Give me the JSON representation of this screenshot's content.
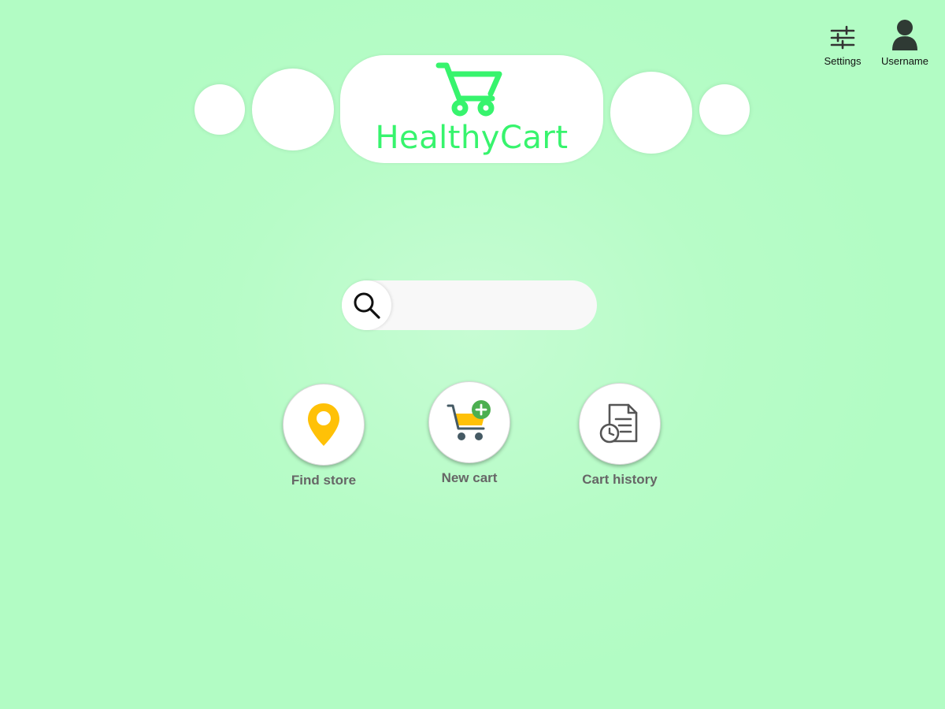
{
  "header": {
    "settings": {
      "label": "Settings",
      "icon": "settings-sliders-icon"
    },
    "user": {
      "label": "Username",
      "icon": "user-icon"
    }
  },
  "logo": {
    "text": "HealthyCart",
    "icon": "shopping-cart-icon",
    "color": "#37f46d"
  },
  "search": {
    "icon": "search-icon",
    "value": "",
    "placeholder": ""
  },
  "actions": [
    {
      "label": "Find store",
      "icon": "location-pin-icon"
    },
    {
      "label": "New cart",
      "icon": "add-to-cart-icon"
    },
    {
      "label": "Cart history",
      "icon": "document-history-icon"
    }
  ],
  "colors": {
    "background": "#b2fcc4",
    "brand_green": "#37f46d",
    "pin_yellow": "#ffc107",
    "add_badge_green": "#4caf50",
    "icon_dark": "#333333",
    "label_gray": "#666666"
  }
}
